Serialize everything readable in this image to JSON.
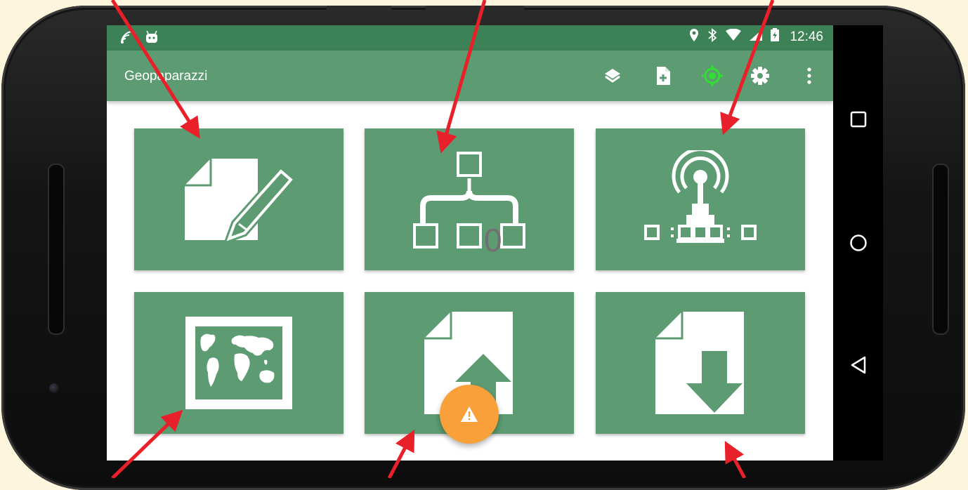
{
  "statusbar": {
    "time": "12:46",
    "left_icons": [
      "wifi-signal-icon",
      "android-icon"
    ],
    "right_icons": [
      "location-icon",
      "bluetooth-icon",
      "wifi-icon",
      "cell-signal-icon",
      "battery-charging-icon"
    ]
  },
  "toolbar": {
    "title": "Geopaparazzi",
    "actions": [
      "layers-icon",
      "add-note-icon",
      "gps-target-icon",
      "settings-icon",
      "more-options-icon"
    ]
  },
  "tiles": [
    {
      "name": "notes-tile",
      "icon": "note-edit-icon"
    },
    {
      "name": "metadata-tile",
      "icon": "hierarchy-icon",
      "badge": "0"
    },
    {
      "name": "gps-log-tile",
      "icon": "gps-antenna-icon"
    },
    {
      "name": "map-view-tile",
      "icon": "world-map-icon"
    },
    {
      "name": "export-tile",
      "icon": "file-export-icon"
    },
    {
      "name": "import-tile",
      "icon": "file-import-icon"
    }
  ],
  "fab": {
    "icon": "warning-icon"
  },
  "nav_buttons": [
    "recent-apps-icon",
    "home-icon",
    "back-icon"
  ],
  "colors": {
    "statusbar": "#3d8156",
    "toolbar": "#5d9b72",
    "tile": "#5d9b72",
    "gps_active": "#33dd33",
    "fab": "#f9a03a",
    "annotation_arrow": "#e8202a",
    "background": "#fdf6dc"
  }
}
